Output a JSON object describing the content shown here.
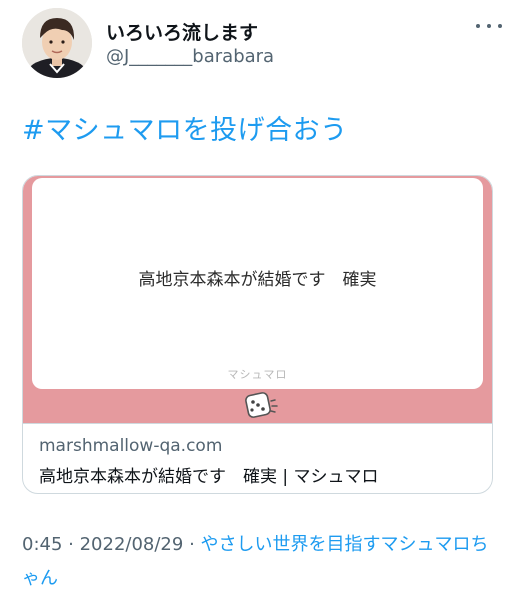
{
  "author": {
    "display_name": "いろいろ流します",
    "handle": "@J_______barabara"
  },
  "tweet": {
    "hashtag": "#マシュマロを投げ合おう"
  },
  "card": {
    "image_text": "高地京本森本が結婚です　確実",
    "watermark": "マシュマロ",
    "domain": "marshmallow-qa.com",
    "title": "高地京本森本が結婚です　確実 | マシュマロ",
    "accent_color": "#e59a9e"
  },
  "footer": {
    "time": "0:45",
    "separator": " · ",
    "date": "2022/08/29",
    "source": "やさしい世界を目指すマシュマロちゃん"
  },
  "icons": [
    "more-icon",
    "dice-icon"
  ]
}
